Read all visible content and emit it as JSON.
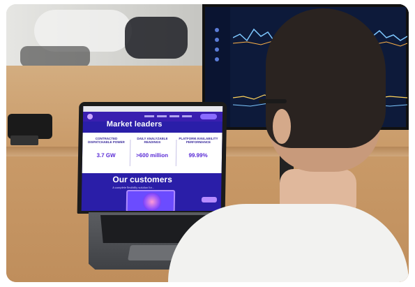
{
  "screen": {
    "hero_title": "Market leaders",
    "stats": [
      {
        "label": "CONTRACTED DISPATCHABLE POWER",
        "value": "3.7 GW"
      },
      {
        "label": "DAILY ANALYZABLE READINGS",
        "value": ">600 million"
      },
      {
        "label": "PLATFORM AVAILABILITY PERFORMANCE",
        "value": "99.99%"
      }
    ],
    "customers_title": "Our customers",
    "customers_subtitle": "A complete flexibility solution for..."
  },
  "colors": {
    "brand_purple": "#2a1ea8",
    "accent_violet": "#8a6cff",
    "desk_wood": "#c99a68",
    "shirt_white": "#f2f2f0"
  }
}
